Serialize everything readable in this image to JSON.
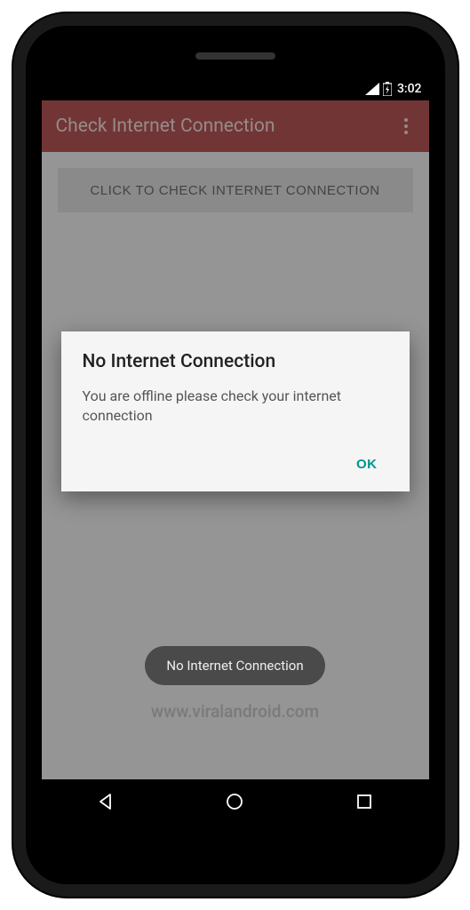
{
  "status_bar": {
    "time": "3:02"
  },
  "app_bar": {
    "title": "Check Internet Connection"
  },
  "main": {
    "check_button_label": "CLICK TO CHECK INTERNET CONNECTION"
  },
  "dialog": {
    "title": "No Internet Connection",
    "message": "You are offline please check your internet connection",
    "ok_label": "OK"
  },
  "toast": {
    "text": "No Internet Connection"
  },
  "footer": {
    "watermark": "www.viralandroid.com"
  }
}
